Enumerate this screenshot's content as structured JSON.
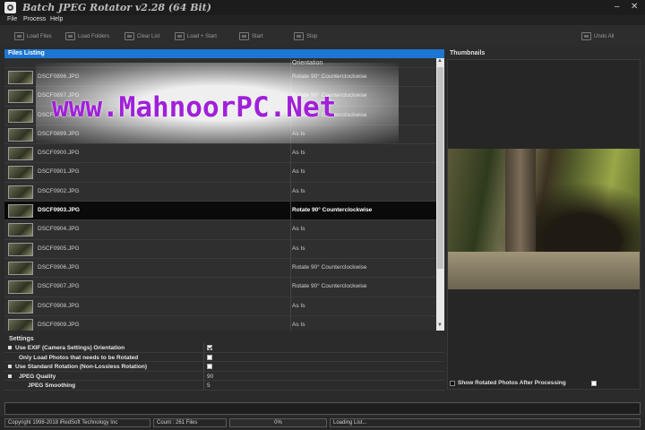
{
  "window": {
    "title": "Batch JPEG Rotator v2.28 (64 Bit)",
    "minimize": "–",
    "close": "✕"
  },
  "menu": [
    "File",
    "Process",
    "Help"
  ],
  "toolbar": {
    "load_files": "Load Files",
    "load_folders": "Load Folders",
    "clear_list": "Clear List",
    "load_start": "Load + Start",
    "start": "Start",
    "stop": "Stop",
    "undo_all": "Undo All"
  },
  "files": {
    "header": "Files Listing",
    "col_orientation": "Orientation",
    "rows": [
      {
        "name": "DSCF0896.JPG",
        "orientation": "Rotate 90° Counterclockwise",
        "selected": false
      },
      {
        "name": "DSCF0897.JPG",
        "orientation": "Rotate 90° Counterclockwise",
        "selected": false
      },
      {
        "name": "DSCF0898.JPG",
        "orientation": "Rotate 90° Counterclockwise",
        "selected": false
      },
      {
        "name": "DSCF0899.JPG",
        "orientation": "As Is",
        "selected": false
      },
      {
        "name": "DSCF0900.JPG",
        "orientation": "As Is",
        "selected": false
      },
      {
        "name": "DSCF0901.JPG",
        "orientation": "As Is",
        "selected": false
      },
      {
        "name": "DSCF0902.JPG",
        "orientation": "As Is",
        "selected": false
      },
      {
        "name": "DSCF0903.JPG",
        "orientation": "Rotate 90° Counterclockwise",
        "selected": true
      },
      {
        "name": "DSCF0904.JPG",
        "orientation": "As Is",
        "selected": false
      },
      {
        "name": "DSCF0905.JPG",
        "orientation": "As Is",
        "selected": false
      },
      {
        "name": "DSCF0906.JPG",
        "orientation": "Rotate 90° Counterclockwise",
        "selected": false
      },
      {
        "name": "DSCF0907.JPG",
        "orientation": "Rotate 90° Counterclockwise",
        "selected": false
      },
      {
        "name": "DSCF0908.JPG",
        "orientation": "As Is",
        "selected": false
      },
      {
        "name": "DSCF0909.JPG",
        "orientation": "As Is",
        "selected": false
      }
    ]
  },
  "watermark": "www.MahnoorPC.Net",
  "thumbnails": {
    "title": "Thumbnails",
    "show_rotated_label": "Show Rotated Photos After Processing",
    "show_rotated_checked": false
  },
  "settings": {
    "title": "Settings",
    "use_exif_label": "Use EXIF (Camera Settings) Orientation",
    "use_exif_checked": true,
    "only_load_label": "Only Load Photos that needs to be Rotated",
    "only_load_checked": false,
    "use_standard_label": "Use Standard Rotation (Non-Lossless Rotation)",
    "use_standard_checked": false,
    "jpeg_quality_label": "JPEG Quality",
    "jpeg_quality_value": "90",
    "jpeg_smoothing_label": "JPEG Smoothing",
    "jpeg_smoothing_value": "5"
  },
  "status": {
    "copyright": "Copyright 1998-2018 iRedSoft Technology Inc",
    "count": "Count : 261 Files",
    "progress": "0%",
    "message": "Loading List..."
  }
}
